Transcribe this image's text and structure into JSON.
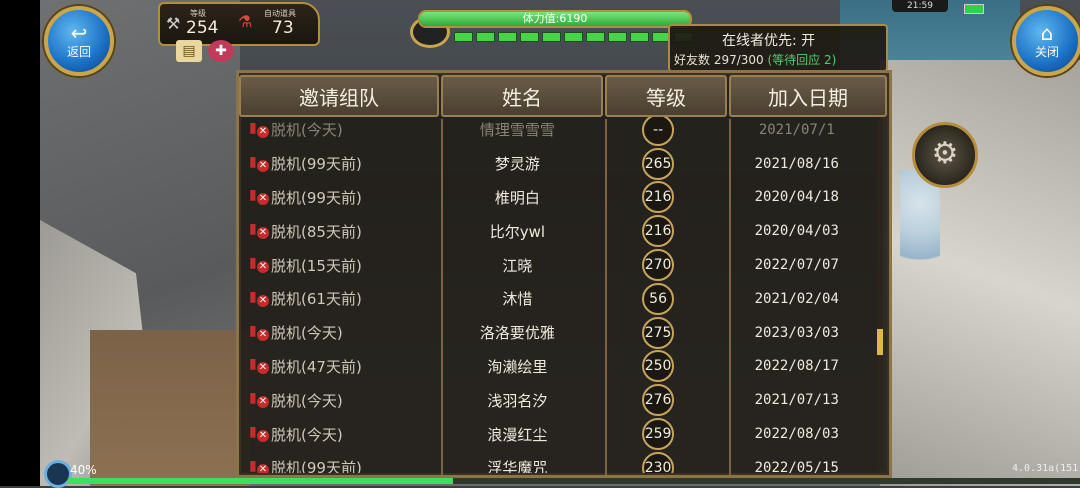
{
  "hud": {
    "back_label": "返回",
    "close_label": "关闭",
    "level_label": "等级",
    "level_value": "254",
    "auto_item_label": "自动道具",
    "auto_item_value": "73",
    "stamina_text": "体力值:6190",
    "stamina_fraction": 1.0,
    "clock": "21:59",
    "loading_percent": "40%",
    "progress_fraction": 0.38,
    "version": "4.0.31a(151)"
  },
  "online": {
    "title": "在线者优先: 开",
    "friends_label": "好友数 297/300",
    "pending": "(等待回应 2)"
  },
  "table": {
    "headers": [
      "邀请组队",
      "姓名",
      "等级",
      "加入日期"
    ],
    "partial_row": {
      "status": "脱机(今天)",
      "name": "情理雪雪雪",
      "level": "--",
      "date": "2021/07/1"
    },
    "rows": [
      {
        "status": "脱机(99天前)",
        "name": "梦灵游",
        "level": "265",
        "date": "2021/08/16"
      },
      {
        "status": "脱机(99天前)",
        "name": "椎明白",
        "level": "216",
        "date": "2020/04/18"
      },
      {
        "status": "脱机(85天前)",
        "name": "比尔ywl",
        "level": "216",
        "date": "2020/04/03"
      },
      {
        "status": "脱机(15天前)",
        "name": "江晓",
        "level": "270",
        "date": "2022/07/07"
      },
      {
        "status": "脱机(61天前)",
        "name": "沐惜",
        "level": "56",
        "date": "2021/02/04"
      },
      {
        "status": "脱机(今天)",
        "name": "洛洛要优雅",
        "level": "275",
        "date": "2023/03/03"
      },
      {
        "status": "脱机(47天前)",
        "name": "洵濑绘里",
        "level": "250",
        "date": "2022/08/17"
      },
      {
        "status": "脱机(今天)",
        "name": "浅羽名汐",
        "level": "276",
        "date": "2021/07/13"
      },
      {
        "status": "脱机(今天)",
        "name": "浪漫红尘",
        "level": "259",
        "date": "2022/08/03"
      },
      {
        "status": "脱机(99天前)",
        "name": "浮华魔咒",
        "level": "230",
        "date": "2022/05/15"
      }
    ]
  },
  "icons": {
    "back": "back-arrow-icon",
    "close": "home-icon",
    "settings": "gears-icon",
    "offline": "offline-phone-icon"
  },
  "colors": {
    "accent_gold": "#c9a54c",
    "stamina_green": "#47d34a",
    "pending_green": "#4fd06e",
    "offline_red": "#c92a2a"
  }
}
